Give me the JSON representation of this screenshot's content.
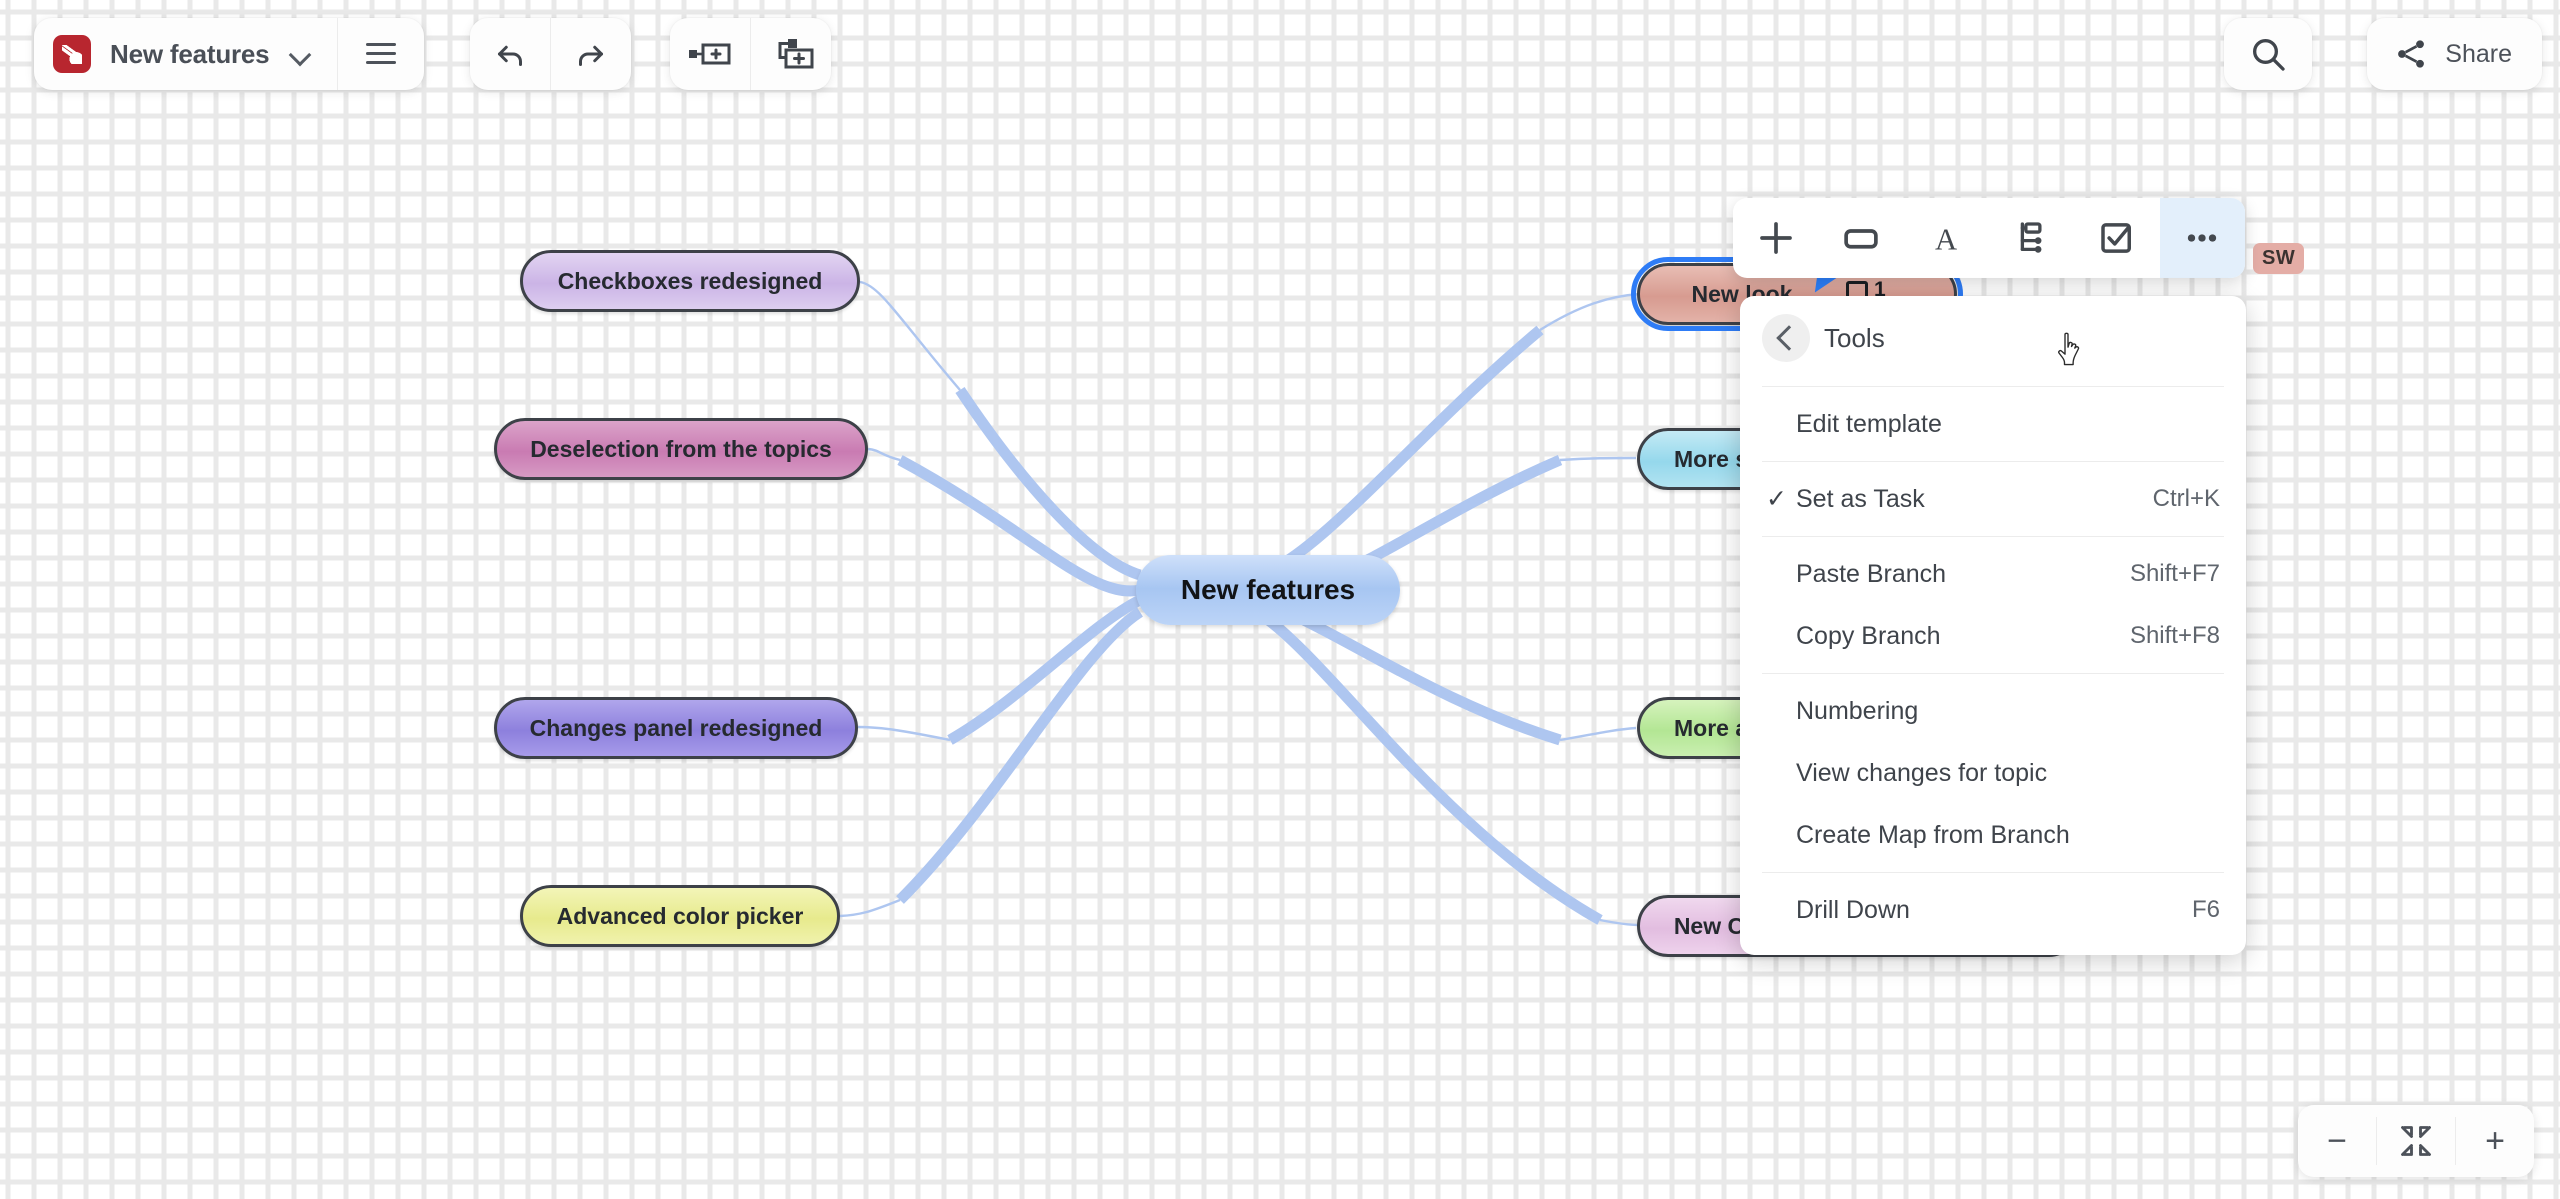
{
  "app": {
    "logo_name": "mindmanager-logo",
    "document_title": "New features"
  },
  "topbar": {
    "doc_dropdown_icon": "chevron-down-icon",
    "menu_icon": "hamburger-menu-icon",
    "undo_icon": "undo-arrow-icon",
    "redo_icon": "redo-arrow-icon",
    "insert_topic_icon": "insert-sibling-topic-icon",
    "insert_subtopic_icon": "insert-subtopic-icon",
    "search_icon": "search-icon",
    "share_icon": "share-icon",
    "share_label": "Share"
  },
  "map": {
    "central": {
      "label": "New features"
    },
    "left_topics": [
      {
        "label": "Checkboxes redesigned"
      },
      {
        "label": "Deselection from the topics"
      },
      {
        "label": "Changes panel redesigned"
      },
      {
        "label": "Advanced color picker"
      }
    ],
    "right_topics": [
      {
        "label": "New look",
        "selected": true,
        "comment_count": "1",
        "avatar": "SW"
      },
      {
        "label": "More spa"
      },
      {
        "label": "More a"
      },
      {
        "label": "New Comments and Notes panels"
      }
    ],
    "colors": {
      "central": "#a7c6f2",
      "checkboxes": "#d2bfe8",
      "deselection": "#d087b8",
      "changes_panel": "#9a8ee0",
      "color_picker": "#eef0a0",
      "new_look": "#dca99f",
      "more_space": "#a6dced",
      "more_a": "#bfe8a6",
      "comments_notes": "#e4c4e2",
      "branch_line": "#aec6f0",
      "selection": "#2e7cf6"
    }
  },
  "format_toolbar": {
    "items": [
      {
        "icon": "plus-icon",
        "active": false
      },
      {
        "icon": "shape-rectangle-icon",
        "active": false
      },
      {
        "icon": "text-format-icon",
        "active": false
      },
      {
        "icon": "topic-layout-icon",
        "active": false
      },
      {
        "icon": "checkbox-task-icon",
        "active": false
      },
      {
        "icon": "more-ellipsis-icon",
        "active": true
      }
    ]
  },
  "context_menu": {
    "back_icon": "chevron-left-icon",
    "title": "Tools",
    "groups": [
      [
        {
          "label": "Edit template",
          "shortcut": "",
          "checked": false
        }
      ],
      [
        {
          "label": "Set as Task",
          "shortcut": "Ctrl+K",
          "checked": true
        }
      ],
      [
        {
          "label": "Paste Branch",
          "shortcut": "Shift+F7",
          "checked": false
        },
        {
          "label": "Copy Branch",
          "shortcut": "Shift+F8",
          "checked": false
        }
      ],
      [
        {
          "label": "Numbering",
          "shortcut": "",
          "checked": false
        },
        {
          "label": "View changes for topic",
          "shortcut": "",
          "checked": false
        },
        {
          "label": "Create Map from Branch",
          "shortcut": "",
          "checked": false
        }
      ],
      [
        {
          "label": "Drill Down",
          "shortcut": "F6",
          "checked": false
        }
      ]
    ]
  },
  "zoom_controls": {
    "zoom_out_icon": "minus-icon",
    "fit_icon": "fit-to-screen-icon",
    "zoom_in_icon": "plus-icon",
    "zoom_out_label": "−",
    "zoom_in_label": "+"
  }
}
